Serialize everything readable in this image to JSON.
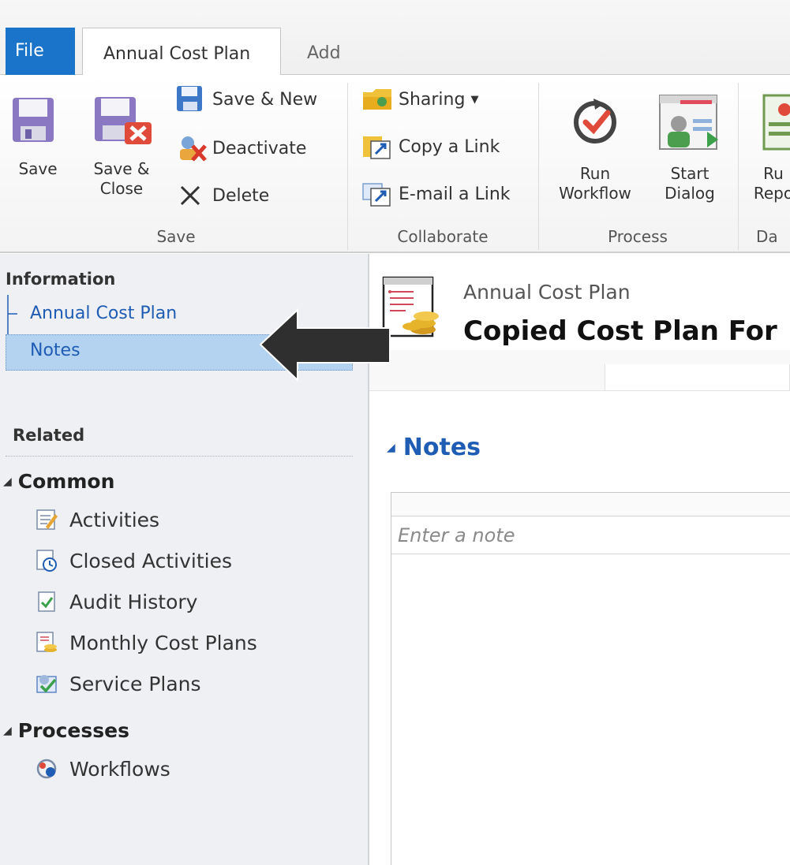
{
  "tabs": {
    "file": "File",
    "main": "Annual Cost Plan",
    "add": "Add"
  },
  "ribbon": {
    "save_group": {
      "label": "Save",
      "save": "Save",
      "save_close_line1": "Save &",
      "save_close_line2": "Close",
      "save_new": "Save & New",
      "deactivate": "Deactivate",
      "delete": "Delete"
    },
    "collaborate_group": {
      "label": "Collaborate",
      "sharing": "Sharing",
      "copy_link": "Copy a Link",
      "email_link": "E-mail a Link"
    },
    "process_group": {
      "label": "Process",
      "run_workflow_line1": "Run",
      "run_workflow_line2": "Workflow",
      "start_dialog_line1": "Start",
      "start_dialog_line2": "Dialog"
    },
    "data_group": {
      "label": "Da",
      "run_report_line1": "Ru",
      "run_report_line2": "Repo"
    }
  },
  "nav": {
    "information_heading": "Information",
    "information_items": [
      "Annual Cost Plan",
      "Notes"
    ],
    "selected_item": "Notes",
    "related_heading": "Related",
    "common_section": "Common",
    "common_items": [
      {
        "label": "Activities",
        "icon": "activities-icon"
      },
      {
        "label": "Closed Activities",
        "icon": "closed-activities-icon"
      },
      {
        "label": "Audit History",
        "icon": "audit-history-icon"
      },
      {
        "label": "Monthly Cost Plans",
        "icon": "monthly-cost-plans-icon"
      },
      {
        "label": "Service Plans",
        "icon": "service-plans-icon"
      }
    ],
    "processes_section": "Processes",
    "processes_items": [
      {
        "label": "Workflows",
        "icon": "workflows-icon"
      }
    ]
  },
  "record": {
    "entity": "Annual Cost Plan",
    "title": "Copied Cost Plan For"
  },
  "notes": {
    "heading": "Notes",
    "placeholder": "Enter a note"
  },
  "colors": {
    "accent_blue": "#1a74c9",
    "link_blue": "#1f5cb4",
    "selected_bg": "#b4d3f0",
    "nav_bg": "#eef0f4"
  }
}
